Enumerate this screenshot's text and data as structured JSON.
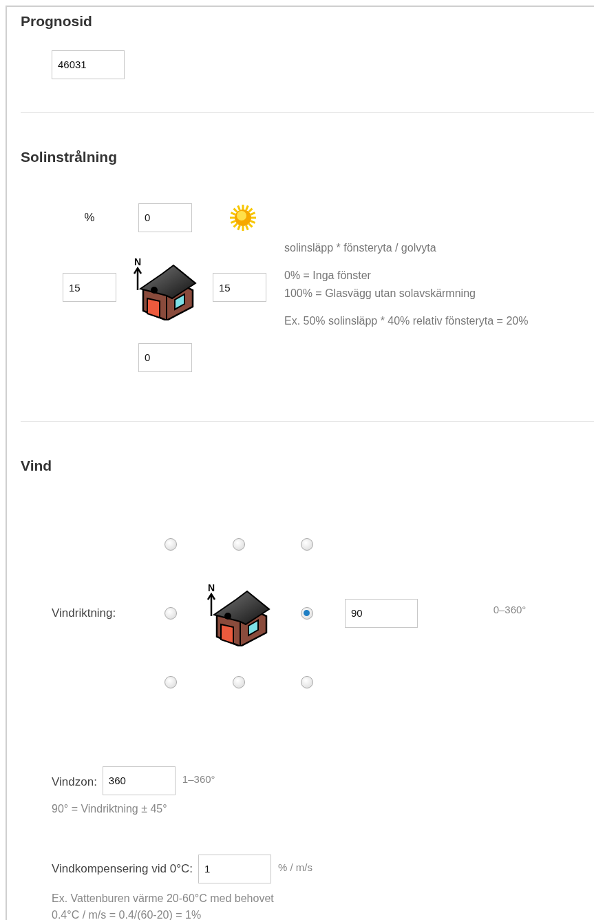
{
  "prognosid": {
    "heading": "Prognosid",
    "value": "46031"
  },
  "solar": {
    "heading": "Solinstrålning",
    "unit": "%",
    "north": "0",
    "west": "15",
    "east": "15",
    "south": "0",
    "north_label": "N",
    "notes": [
      [
        "solinsläpp * fönsteryta / golvyta"
      ],
      [
        "0% = Inga fönster",
        "100% = Glasvägg utan solavskärmning"
      ],
      [
        "Ex. 50% solinsläpp * 40% relativ fönsteryta = 20%"
      ]
    ]
  },
  "wind": {
    "heading": "Vind",
    "direction_label": "Vindriktning:",
    "north_label": "N",
    "directions": [
      {
        "selected": false
      },
      {
        "selected": false
      },
      {
        "selected": false
      },
      {
        "selected": false
      },
      {
        "selected": true
      },
      {
        "selected": false
      },
      {
        "selected": false
      },
      {
        "selected": false
      }
    ],
    "direction_value": "90",
    "direction_range": "0–360°",
    "zone_label": "Vindzon:",
    "zone_value": "360",
    "zone_range": "1–360°",
    "zone_hint": "90° = Vindriktning ± 45°",
    "comp_label": "Vindkompensering vid 0°C:",
    "comp_value": "1",
    "comp_unit": "% / m/s",
    "comp_hint": [
      "Ex. Vattenburen värme 20-60°C med behovet",
      "0.4°C / m/s = 0.4/(60-20) = 1%"
    ]
  }
}
